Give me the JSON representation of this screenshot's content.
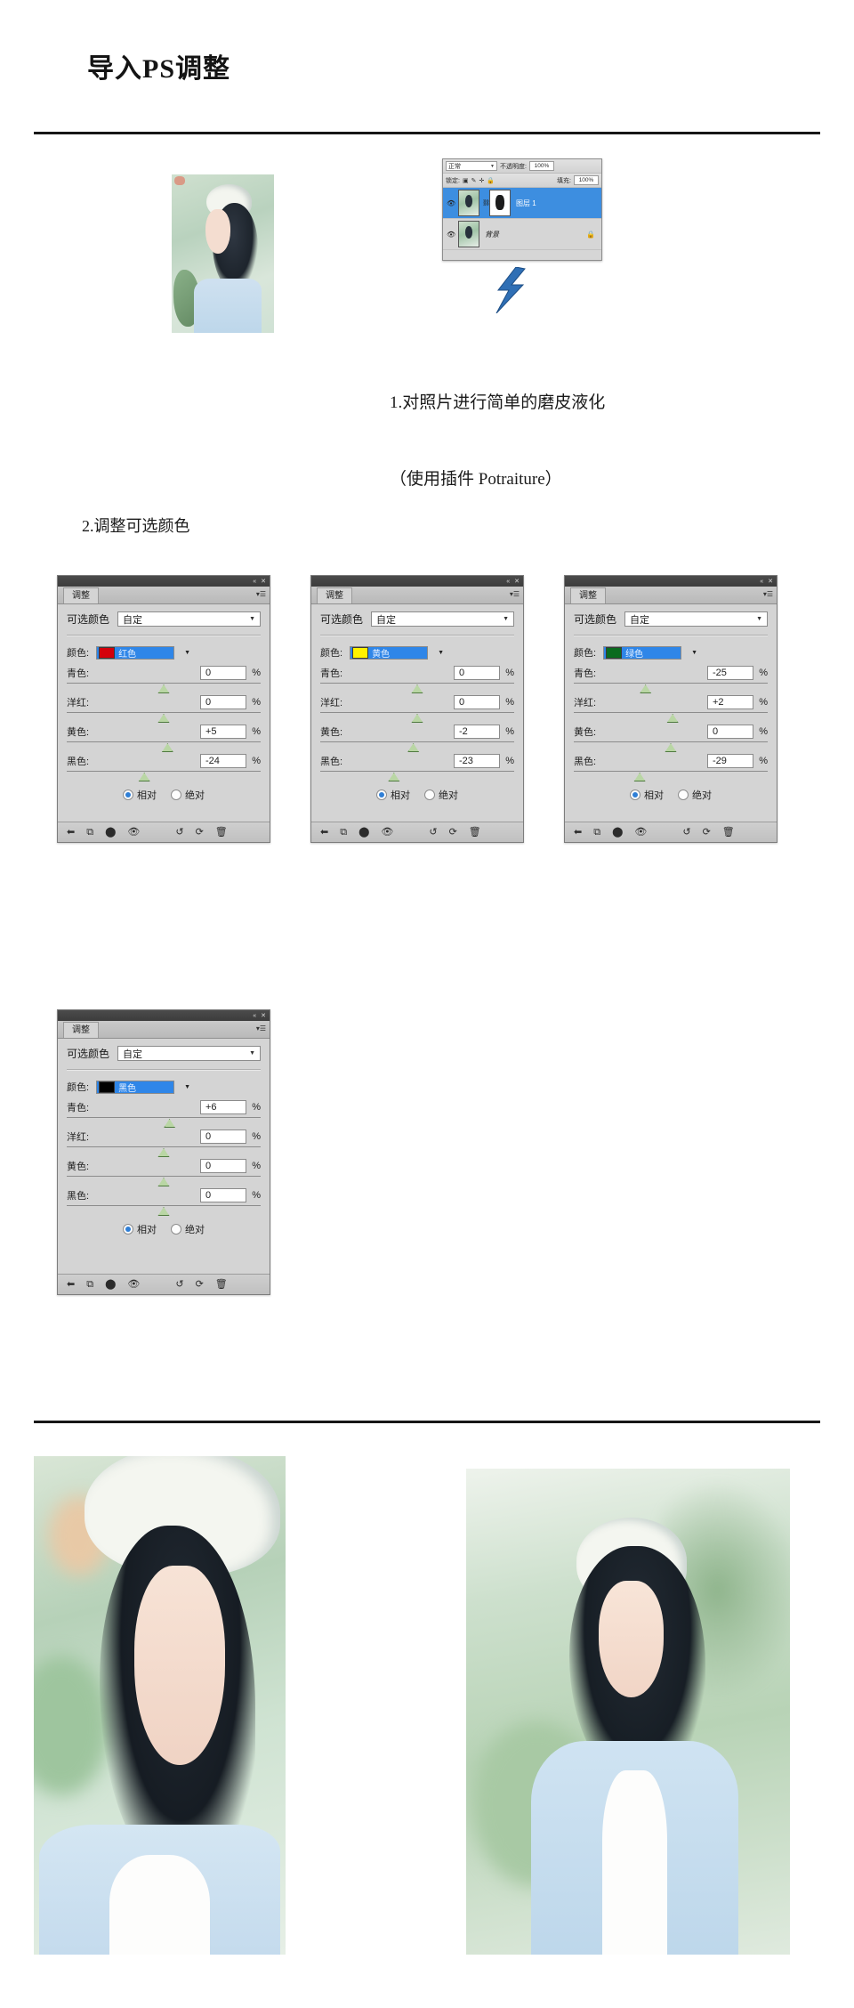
{
  "header": {
    "title": "导入PS调整"
  },
  "steps": {
    "step1_line1": "1.对照片进行简单的磨皮液化",
    "step1_line2": "（使用插件 Potraiture）",
    "step2": "2.调整可选颜色"
  },
  "layers_panel": {
    "blend_mode": "正常",
    "opacity_label": "不透明度:",
    "opacity_value": "100%",
    "lock_label": "锁定:",
    "fill_label": "填充:",
    "fill_value": "100%",
    "lock_icons": [
      "transparency-lock-icon",
      "brush-lock-icon",
      "move-lock-icon",
      "all-lock-icon"
    ],
    "layers": [
      {
        "name": "图层 1",
        "selected": true,
        "has_mask": true,
        "locked": false
      },
      {
        "name": "背景",
        "selected": false,
        "has_mask": false,
        "locked": true
      }
    ]
  },
  "panel_common": {
    "tab_label": "调整",
    "preset_label": "可选颜色",
    "preset_value": "自定",
    "color_label": "颜色:",
    "cyan_label": "青色:",
    "magenta_label": "洋红:",
    "yellow_label": "黄色:",
    "black_label": "黑色:",
    "percent": "%",
    "relative_label": "相对",
    "absolute_label": "绝对",
    "method_selected": "相对",
    "toolbar_icons": [
      "back-arrow-icon",
      "clip-to-layer-icon",
      "mask-view-icon",
      "preview-eye-icon",
      "reset-previous-icon",
      "reset-icon",
      "trash-icon"
    ],
    "titlebar_icons": [
      "collapse-icon",
      "close-icon"
    ]
  },
  "adjustment_panels": [
    {
      "id": "red",
      "color_name": "红色",
      "swatch_hex": "#d4000a",
      "cyan": "0",
      "magenta": "0",
      "yellow": "+5",
      "black": "-24",
      "knob_pct": {
        "cyan": 50,
        "magenta": 50,
        "yellow": 52,
        "black": 40
      }
    },
    {
      "id": "yellow",
      "color_name": "黄色",
      "swatch_hex": "#fff200",
      "cyan": "0",
      "magenta": "0",
      "yellow": "-2",
      "black": "-23",
      "knob_pct": {
        "cyan": 50,
        "magenta": 50,
        "yellow": 48,
        "black": 38
      }
    },
    {
      "id": "green",
      "color_name": "绿色",
      "swatch_hex": "#0a6b1e",
      "cyan": "-25",
      "magenta": "+2",
      "yellow": "0",
      "black": "-29",
      "knob_pct": {
        "cyan": 37,
        "magenta": 51,
        "yellow": 50,
        "black": 34
      }
    },
    {
      "id": "black",
      "color_name": "黑色",
      "swatch_hex": "#000000",
      "cyan": "+6",
      "magenta": "0",
      "yellow": "0",
      "black": "0",
      "knob_pct": {
        "cyan": 53,
        "magenta": 50,
        "yellow": 50,
        "black": 50
      }
    }
  ],
  "photos": {
    "step1_thumb": "portrait-thumbnail-original",
    "result_left": "portrait-result-closeup",
    "result_right": "portrait-result-fullshot"
  },
  "colors": {
    "accent_blue": "#2f86e8",
    "panel_gray": "#d4d4d4",
    "rule_black": "#171717"
  }
}
